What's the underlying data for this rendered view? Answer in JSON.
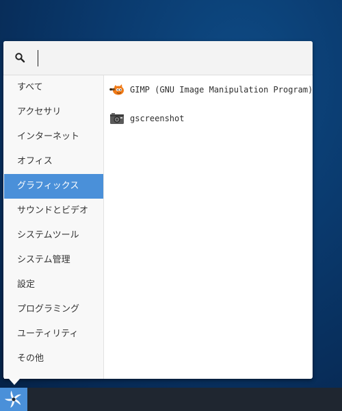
{
  "search": {
    "placeholder": "",
    "value": ""
  },
  "categories": [
    {
      "label": "すべて",
      "selected": false
    },
    {
      "label": "アクセサリ",
      "selected": false
    },
    {
      "label": "インターネット",
      "selected": false
    },
    {
      "label": "オフィス",
      "selected": false
    },
    {
      "label": "グラフィックス",
      "selected": true
    },
    {
      "label": "サウンドとビデオ",
      "selected": false
    },
    {
      "label": "システムツール",
      "selected": false
    },
    {
      "label": "システム管理",
      "selected": false
    },
    {
      "label": "設定",
      "selected": false
    },
    {
      "label": "プログラミング",
      "selected": false
    },
    {
      "label": "ユーティリティ",
      "selected": false
    },
    {
      "label": "その他",
      "selected": false
    }
  ],
  "apps": [
    {
      "label": "GIMP (GNU Image Manipulation Program)",
      "icon": "gimp-icon"
    },
    {
      "label": "gscreenshot",
      "icon": "camera-icon"
    }
  ],
  "taskbar": {
    "start_icon": "menu-logo-icon"
  },
  "colors": {
    "accent": "#4a90d9",
    "desktop": "#0a3a6e",
    "taskbar": "#1f2630"
  }
}
